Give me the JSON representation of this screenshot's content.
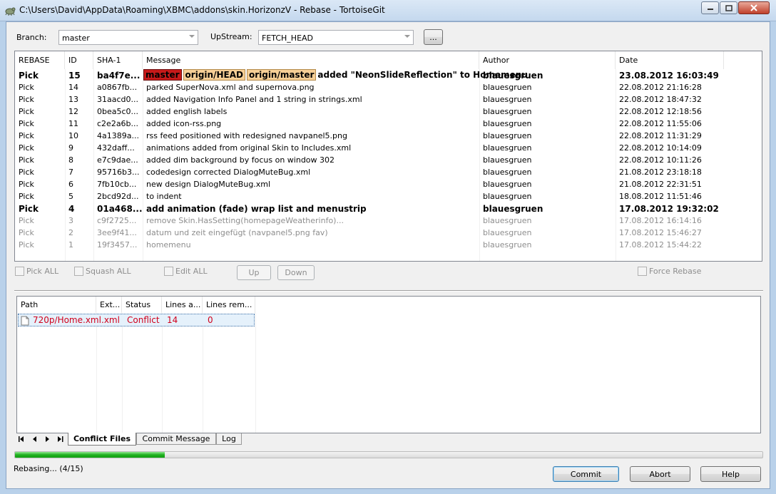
{
  "window": {
    "title": "C:\\Users\\David\\AppData\\Roaming\\XBMC\\addons\\skin.HorizonzV - Rebase - TortoiseGit",
    "icon": "tortoisegit-icon"
  },
  "branch": {
    "label": "Branch:",
    "value": "master"
  },
  "upstream": {
    "label": "UpStream:",
    "value": "FETCH_HEAD",
    "browse_label": "..."
  },
  "commit_list": {
    "columns": [
      "REBASE",
      "ID",
      "SHA-1",
      "Message",
      "Author",
      "Date"
    ],
    "rows": [
      {
        "action": "Pick",
        "id": "15",
        "sha": "ba4f7e...",
        "refs": [
          "master",
          "origin/HEAD",
          "origin/master"
        ],
        "message": "added \"NeonSlideReflection\" to Homemenu",
        "author": "blauesgruen",
        "date": "23.08.2012 16:03:49",
        "style": "bold"
      },
      {
        "action": "Pick",
        "id": "14",
        "sha": "a0867fb...",
        "message": "parked SuperNova.xml and supernova.png",
        "author": "blauesgruen",
        "date": "22.08.2012 21:16:28",
        "style": "normal"
      },
      {
        "action": "Pick",
        "id": "13",
        "sha": "31aacd0...",
        "message": "added Navigation Info Panel and 1 string in strings.xml",
        "author": "blauesgruen",
        "date": "22.08.2012 18:47:32",
        "style": "normal"
      },
      {
        "action": "Pick",
        "id": "12",
        "sha": "0bea5c0...",
        "message": "added english labels",
        "author": "blauesgruen",
        "date": "22.08.2012 12:18:56",
        "style": "normal"
      },
      {
        "action": "Pick",
        "id": "11",
        "sha": "c2e2a6b...",
        "message": "added icon-rss.png",
        "author": "blauesgruen",
        "date": "22.08.2012 11:55:06",
        "style": "normal"
      },
      {
        "action": "Pick",
        "id": "10",
        "sha": "4a1389a...",
        "message": "rss feed positioned with redesigned navpanel5.png",
        "author": "blauesgruen",
        "date": "22.08.2012 11:31:29",
        "style": "normal"
      },
      {
        "action": "Pick",
        "id": "9",
        "sha": "432daff...",
        "message": "animations added from original Skin to Includes.xml",
        "author": "blauesgruen",
        "date": "22.08.2012 10:14:09",
        "style": "normal"
      },
      {
        "action": "Pick",
        "id": "8",
        "sha": "e7c9dae...",
        "message": "added dim background by focus on window 302",
        "author": "blauesgruen",
        "date": "22.08.2012 10:11:26",
        "style": "normal"
      },
      {
        "action": "Pick",
        "id": "7",
        "sha": "95716b3...",
        "message": "codedesign corrected DialogMuteBug.xml",
        "author": "blauesgruen",
        "date": "21.08.2012 23:18:18",
        "style": "normal"
      },
      {
        "action": "Pick",
        "id": "6",
        "sha": "7fb10cb...",
        "message": "new design DialogMuteBug.xml",
        "author": "blauesgruen",
        "date": "21.08.2012 22:31:51",
        "style": "normal"
      },
      {
        "action": "Pick",
        "id": "5",
        "sha": "2bcd92d...",
        "message": "to indent",
        "author": "blauesgruen",
        "date": "18.08.2012 11:51:46",
        "style": "normal"
      },
      {
        "action": "Pick",
        "id": "4",
        "sha": "01a468...",
        "message": "add animation (fade) wrap list and menustrip",
        "author": "blauesgruen",
        "date": "17.08.2012 19:32:02",
        "style": "bold"
      },
      {
        "action": "Pick",
        "id": "3",
        "sha": "c9f2725...",
        "message": "remove Skin.HasSetting(homepageWeatherinfo)...",
        "author": "blauesgruen",
        "date": "17.08.2012 16:14:16",
        "style": "grey"
      },
      {
        "action": "Pick",
        "id": "2",
        "sha": "3ee9f41...",
        "message": "datum und zeit eingefügt (navpanel5.png fav)",
        "author": "blauesgruen",
        "date": "17.08.2012 15:46:27",
        "style": "grey"
      },
      {
        "action": "Pick",
        "id": "1",
        "sha": "19f3457...",
        "message": "homemenu",
        "author": "blauesgruen",
        "date": "17.08.2012 15:44:22",
        "style": "grey"
      }
    ]
  },
  "options": {
    "pick_all": "Pick ALL",
    "squash_all": "Squash ALL",
    "edit_all": "Edit ALL",
    "up": "Up",
    "down": "Down",
    "force_rebase": "Force Rebase"
  },
  "file_list": {
    "columns": [
      "Path",
      "Ext...",
      "Status",
      "Lines a...",
      "Lines rem..."
    ],
    "rows": [
      {
        "path": "720p/Home.xml",
        "ext": ".xml",
        "status": "Conflict",
        "added": "14",
        "removed": "0"
      }
    ]
  },
  "tabs": [
    "Conflict Files",
    "Commit Message",
    "Log"
  ],
  "progress": {
    "fraction": 0.2,
    "status": "Rebasing... (4/15)"
  },
  "buttons": {
    "commit": "Commit",
    "abort": "Abort",
    "help": "Help"
  },
  "colors": {
    "conflict": "#d0001c",
    "progress": "#21b021",
    "ref_local": "#c61a1a",
    "ref_remote": "#f6cf96"
  }
}
